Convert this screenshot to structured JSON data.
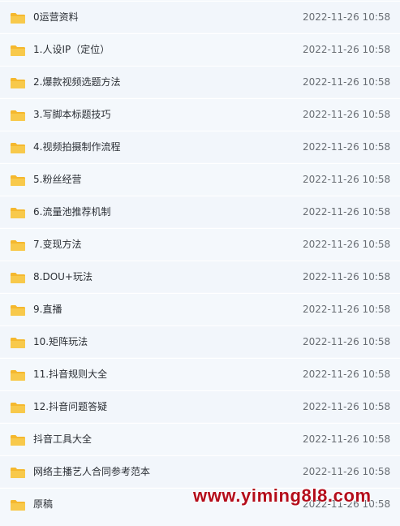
{
  "file_list": {
    "items": [
      {
        "name": "0运营资料",
        "date": "2022-11-26 10:58",
        "icon": "folder-icon"
      },
      {
        "name": "1.人设IP（定位）",
        "date": "2022-11-26 10:58",
        "icon": "folder-icon"
      },
      {
        "name": "2.爆款视频选题方法",
        "date": "2022-11-26 10:58",
        "icon": "folder-icon"
      },
      {
        "name": "3.写脚本标题技巧",
        "date": "2022-11-26 10:58",
        "icon": "folder-icon"
      },
      {
        "name": "4.视频拍摄制作流程",
        "date": "2022-11-26 10:58",
        "icon": "folder-icon"
      },
      {
        "name": "5.粉丝经营",
        "date": "2022-11-26 10:58",
        "icon": "folder-icon"
      },
      {
        "name": "6.流量池推荐机制",
        "date": "2022-11-26 10:58",
        "icon": "folder-icon"
      },
      {
        "name": "7.变现方法",
        "date": "2022-11-26 10:58",
        "icon": "folder-icon"
      },
      {
        "name": "8.DOU+玩法",
        "date": "2022-11-26 10:58",
        "icon": "folder-icon"
      },
      {
        "name": "9.直播",
        "date": "2022-11-26 10:58",
        "icon": "folder-icon"
      },
      {
        "name": "10.矩阵玩法",
        "date": "2022-11-26 10:58",
        "icon": "folder-icon"
      },
      {
        "name": "11.抖音规则大全",
        "date": "2022-11-26 10:58",
        "icon": "folder-icon"
      },
      {
        "name": "12.抖音问题答疑",
        "date": "2022-11-26 10:58",
        "icon": "folder-icon"
      },
      {
        "name": "抖音工具大全",
        "date": "2022-11-26 10:58",
        "icon": "folder-icon"
      },
      {
        "name": "网络主播艺人合同参考范本",
        "date": "2022-11-26 10:58",
        "icon": "folder-icon"
      },
      {
        "name": "原稿",
        "date": "2022-11-26 10:58",
        "icon": "folder-icon"
      }
    ]
  },
  "watermark": {
    "text": "www.yiming8l8.com"
  },
  "colors": {
    "folder": "#f8c94b",
    "folder_tab": "#f5b82e",
    "watermark": "#b40d1b"
  }
}
